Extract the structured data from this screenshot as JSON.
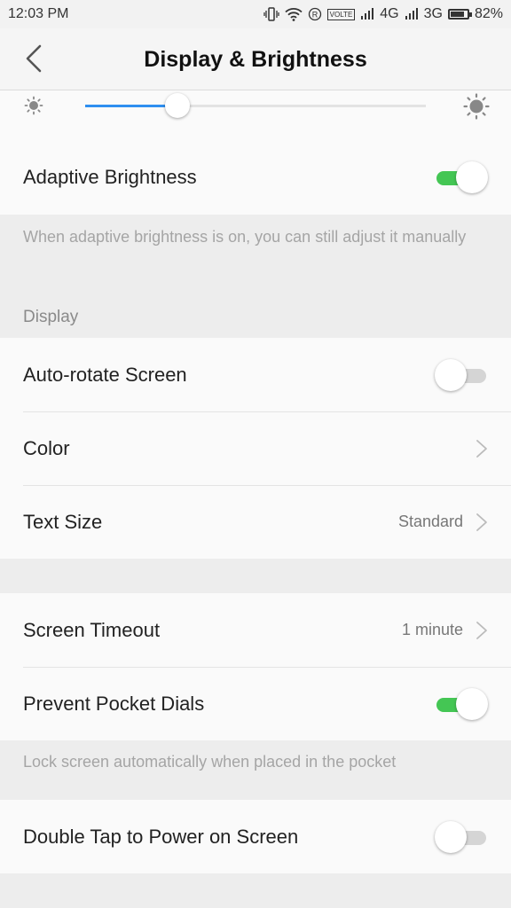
{
  "status_bar": {
    "time": "12:03 PM",
    "volte": "VOLTE",
    "network_1": "4G",
    "network_2": "3G",
    "battery_percent": "82%",
    "battery_level": 0.82,
    "icons": [
      "vibrate-icon",
      "wifi-icon",
      "registered-icon",
      "volte-icon",
      "signal-icon",
      "signal-icon",
      "battery-icon"
    ]
  },
  "header": {
    "title": "Display & Brightness",
    "back_icon": "chevron-left-icon"
  },
  "brightness": {
    "level": 0.27,
    "low_icon": "sun-small-icon",
    "high_icon": "sun-large-icon",
    "accent": "#2e8ff0"
  },
  "adaptive_brightness": {
    "label": "Adaptive Brightness",
    "enabled": true,
    "hint": "When adaptive brightness is on, you can still adjust it manually"
  },
  "display_section": {
    "header": "Display",
    "auto_rotate": {
      "label": "Auto-rotate Screen",
      "enabled": false
    },
    "color": {
      "label": "Color"
    },
    "text_size": {
      "label": "Text Size",
      "value": "Standard"
    }
  },
  "power_section": {
    "screen_timeout": {
      "label": "Screen Timeout",
      "value": "1 minute"
    },
    "pocket_dials": {
      "label": "Prevent Pocket Dials",
      "enabled": true,
      "hint": "Lock screen automatically when placed in the pocket"
    },
    "double_tap": {
      "label": "Double Tap to Power on Screen",
      "enabled": false
    }
  },
  "colors": {
    "toggle_on": "#44c654",
    "toggle_off": "#d5d5d5"
  }
}
